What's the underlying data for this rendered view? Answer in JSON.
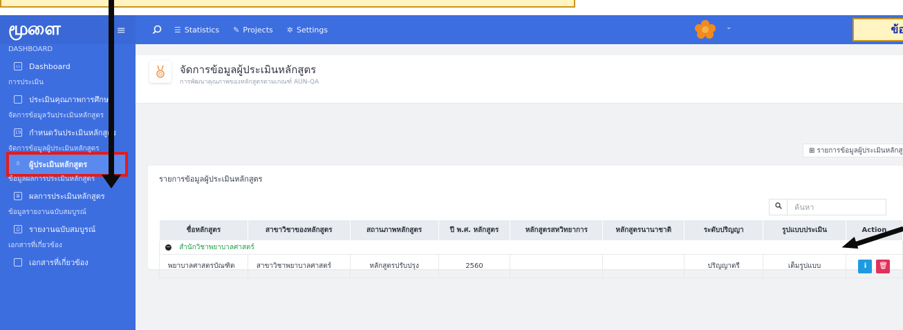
{
  "brand": {
    "logo": "மூளை"
  },
  "navbar": {
    "items": [
      {
        "label": "Statistics",
        "icon": "database-icon"
      },
      {
        "label": "Projects",
        "icon": "edit-icon"
      },
      {
        "label": "Settings",
        "icon": "gear-icon"
      }
    ],
    "callout": "ข้อมูลเลขาฯ ประเมินฯ"
  },
  "sidebar": {
    "sections": [
      {
        "title": "DASHBOARD",
        "item": "Dashboard"
      },
      {
        "title": "การประเมิน",
        "item": "ประเมินคุณภาพการศึกษา"
      },
      {
        "title": "จัดการข้อมูลวันประเมินหลักสูตร",
        "item": "กำหนดวันประเมินหลักสูตร"
      },
      {
        "title": "จัดการข้อมูลผู้ประเมินหลักสูตร",
        "item": "ผู้ประเมินหลักสูตร"
      },
      {
        "title": "ข้อมูลผลการประเมินหลักสูตร",
        "item": "ผลการประเมินหลักสูตร"
      },
      {
        "title": "ข้อมูลรายงานฉบับสมบูรณ์",
        "item": "รายงานฉบับสมบูรณ์"
      },
      {
        "title": "เอกสารที่เกี่ยวข้อง",
        "item": "เอกสารที่เกี่ยวข้อง"
      }
    ]
  },
  "page": {
    "title": "จัดการข้อมูลผู้ประเมินหลักสูตร",
    "subtitle": "การพัฒนาคุณภาพของหลักสูตรตามเกณฑ์ AUN-QA",
    "report_button": "รายการข้อมูลผู้ประเมินหลักสูตร"
  },
  "card": {
    "title": "รายการข้อมูลผู้ประเมินหลักสูตร",
    "search_placeholder": "ค้นหา"
  },
  "table": {
    "headers": [
      "ชื่อหลักสูตร",
      "สาขาวิชาของหลักสูตร",
      "สถานภาพหลักสูตร",
      "ปี พ.ศ. หลักสูตร",
      "หลักสูตรสหวิทยาการ",
      "หลักสูตรนานาชาติ",
      "ระดับปริญญา",
      "รูปแบบประเมิน",
      "Action"
    ],
    "group": "สำนักวิชาพยาบาลศาสตร์",
    "rows": [
      {
        "name": "พยาบาลศาสตรบัณฑิต",
        "major": "สาขาวิชาพยาบาลศาสตร์",
        "status": "หลักสูตรปรับปรุง",
        "year": "2560",
        "interdisciplinary": "",
        "international": "",
        "degree": "ปริญญาตรี",
        "format": "เต็มรูปแบบ"
      }
    ]
  },
  "colors": {
    "primary": "#3d6ee0",
    "callout_bg": "#fff4c2",
    "callout_border": "#c9961a",
    "highlight": "#e51b1b",
    "info": "#1e9be0",
    "danger": "#e0325a"
  }
}
